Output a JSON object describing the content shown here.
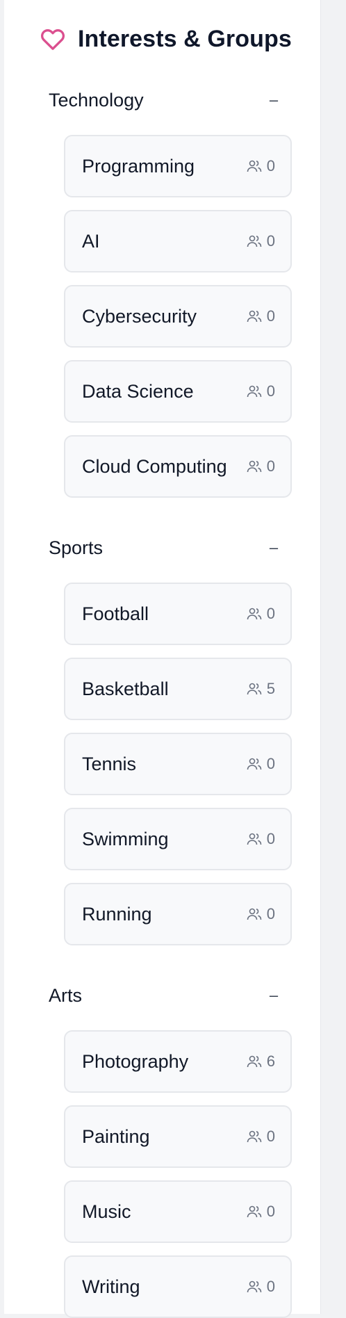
{
  "header": {
    "title": "Interests & Groups",
    "icon": "heart-icon",
    "accent": "#db4f8f"
  },
  "sections": [
    {
      "label": "Technology",
      "toggle": "–",
      "items": [
        {
          "label": "Programming",
          "members": "0"
        },
        {
          "label": "AI",
          "members": "0"
        },
        {
          "label": "Cybersecurity",
          "members": "0"
        },
        {
          "label": "Data Science",
          "members": "0"
        },
        {
          "label": "Cloud Computing",
          "members": "0"
        }
      ]
    },
    {
      "label": "Sports",
      "toggle": "–",
      "items": [
        {
          "label": "Football",
          "members": "0"
        },
        {
          "label": "Basketball",
          "members": "5"
        },
        {
          "label": "Tennis",
          "members": "0"
        },
        {
          "label": "Swimming",
          "members": "0"
        },
        {
          "label": "Running",
          "members": "0"
        }
      ]
    },
    {
      "label": "Arts",
      "toggle": "–",
      "items": [
        {
          "label": "Photography",
          "members": "6"
        },
        {
          "label": "Painting",
          "members": "0"
        },
        {
          "label": "Music",
          "members": "0"
        },
        {
          "label": "Writing",
          "members": "0"
        }
      ]
    }
  ]
}
